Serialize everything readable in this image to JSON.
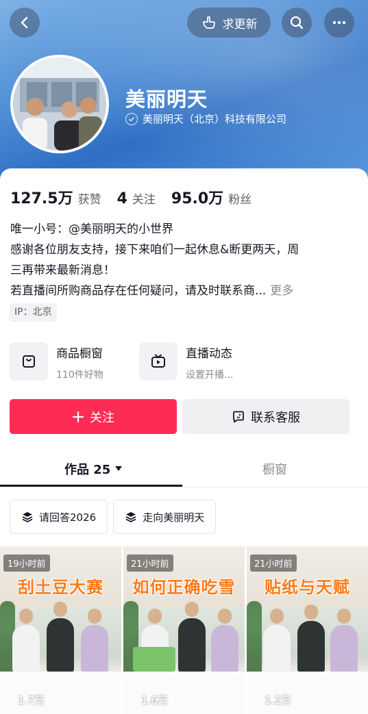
{
  "header": {
    "update_label": "求更新"
  },
  "profile": {
    "name": "美丽明天",
    "verified_org": "美丽明天（北京）科技有限公司"
  },
  "stats": [
    {
      "value": "127.5万",
      "label": "获赞"
    },
    {
      "value": "4",
      "label": "关注"
    },
    {
      "value": "95.0万",
      "label": "粉丝"
    }
  ],
  "bio": {
    "line1": "唯一小号：@美丽明天的小世界",
    "line2": "感谢各位朋友支持，接下来咱们一起休息&断更两天，周",
    "line3": "三再带来最新消息！",
    "line4": "若直播间所购商品存在任何疑问，请及时联系商...",
    "more": "更多"
  },
  "ip": "IP：北京",
  "features": [
    {
      "title": "商品橱窗",
      "subtitle": "110件好物",
      "icon": "bag-icon"
    },
    {
      "title": "直播动态",
      "subtitle": "设置开播...",
      "icon": "tv-icon"
    }
  ],
  "actions": {
    "follow": "关注",
    "contact": "联系客服"
  },
  "tabs": {
    "works": "作品 25",
    "showcase": "橱窗"
  },
  "chips": [
    "请回答2026",
    "走向美丽明天"
  ],
  "videos": [
    {
      "time": "19小时前",
      "title": "刮土豆大赛",
      "likes": "1.7万"
    },
    {
      "time": "21小时前",
      "title": "如何正确吃雪",
      "likes": "1.6万"
    },
    {
      "time": "21小时前",
      "title": "贴纸与天赋",
      "likes": "1.2万"
    }
  ],
  "colors": {
    "accent": "#fe2c55",
    "banner": "#4f8fd6"
  }
}
